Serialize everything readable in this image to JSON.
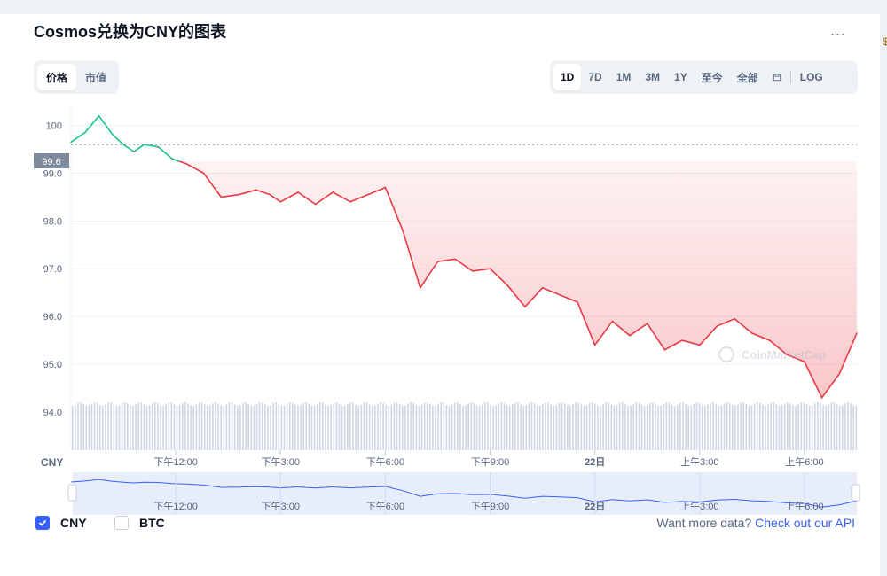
{
  "title": "Cosmos兑换为CNY的图表",
  "more_label": "...",
  "edge_glyph": "$",
  "metric_tabs": [
    {
      "label": "价格",
      "active": true
    },
    {
      "label": "市值",
      "active": false
    }
  ],
  "range_tabs": [
    {
      "label": "1D",
      "active": true
    },
    {
      "label": "7D",
      "active": false
    },
    {
      "label": "1M",
      "active": false
    },
    {
      "label": "3M",
      "active": false
    },
    {
      "label": "1Y",
      "active": false
    },
    {
      "label": "至今",
      "active": false
    },
    {
      "label": "全部",
      "active": false
    }
  ],
  "log_label": "LOG",
  "current_price_label": "99.6",
  "axis_currency": "CNY",
  "watermark": "CoinMarketCap",
  "colors": {
    "up": "#16c784",
    "down": "#ea3943",
    "accent": "#3861fb",
    "volume": "#cfd6e4",
    "navigator_fill": "#e8edfc"
  },
  "chart_data": {
    "type": "line",
    "ylim": [
      93.2,
      100.4
    ],
    "y_ticks": [
      "100",
      "99.0",
      "98.0",
      "97.0",
      "96.0",
      "95.0",
      "94.0"
    ],
    "x_ticks": [
      "下午12:00",
      "下午3:00",
      "下午6:00",
      "下午9:00",
      "22日",
      "上午3:00",
      "上午6:00"
    ],
    "reference_value": 99.6,
    "x": [
      0,
      0.4,
      0.8,
      1.2,
      1.5,
      1.8,
      2.1,
      2.5,
      2.9,
      3.3,
      3.8,
      4.3,
      4.8,
      5.3,
      5.7,
      6.0,
      6.5,
      7.0,
      7.5,
      8.0,
      8.5,
      9.0,
      9.5,
      10.0,
      10.5,
      11.0,
      11.5,
      12.0,
      12.5,
      13.0,
      13.5,
      14.0,
      14.5,
      15.0,
      15.5,
      16.0,
      16.5,
      17.0,
      17.5,
      18.0,
      18.5,
      19.0,
      19.5,
      20.0,
      20.5,
      21.0,
      21.5,
      22.0,
      22.5
    ],
    "values": [
      99.65,
      99.85,
      100.2,
      99.8,
      99.6,
      99.45,
      99.6,
      99.55,
      99.3,
      99.2,
      99.0,
      98.5,
      98.55,
      98.65,
      98.55,
      98.4,
      98.6,
      98.35,
      98.6,
      98.4,
      98.55,
      98.7,
      97.8,
      96.6,
      97.15,
      97.2,
      96.95,
      97.0,
      96.65,
      96.2,
      96.6,
      96.45,
      96.3,
      95.4,
      95.9,
      95.6,
      95.85,
      95.3,
      95.5,
      95.4,
      95.8,
      95.95,
      95.65,
      95.5,
      95.2,
      95.05,
      94.3,
      94.8,
      95.65
    ],
    "series_colors_rule": "green above 99.6, red below"
  },
  "navigator": {
    "x_ticks": [
      "下午12:00",
      "下午3:00",
      "下午6:00",
      "下午9:00",
      "22日",
      "上午3:00",
      "上午6:00"
    ]
  },
  "footer": {
    "checkboxes": [
      {
        "label": "CNY",
        "checked": true
      },
      {
        "label": "BTC",
        "checked": false
      }
    ],
    "api_text": "Want more data?",
    "api_link": "Check out our API"
  }
}
